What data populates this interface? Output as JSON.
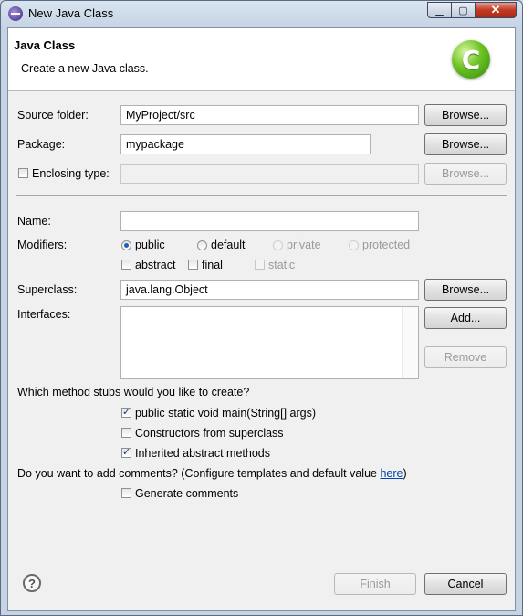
{
  "window": {
    "title": "New Java Class",
    "buttons": {
      "minimize": "▁",
      "maximize": "▢",
      "close": "✕"
    }
  },
  "header": {
    "title": "Java Class",
    "description": "Create a new Java class.",
    "logo_letter": "C"
  },
  "source_folder": {
    "label": "Source folder:",
    "value": "MyProject/src",
    "button": "Browse..."
  },
  "package": {
    "label": "Package:",
    "value": "mypackage",
    "button": "Browse..."
  },
  "enclosing_type": {
    "label": "Enclosing type:",
    "value": "",
    "button": "Browse...",
    "checked": false
  },
  "name": {
    "label": "Name:",
    "value": ""
  },
  "modifiers": {
    "label": "Modifiers:",
    "radios": [
      {
        "label": "public",
        "selected": true,
        "enabled": true
      },
      {
        "label": "default",
        "selected": false,
        "enabled": true
      },
      {
        "label": "private",
        "selected": false,
        "enabled": false
      },
      {
        "label": "protected",
        "selected": false,
        "enabled": false
      }
    ],
    "checks": [
      {
        "label": "abstract",
        "checked": false,
        "enabled": true
      },
      {
        "label": "final",
        "checked": false,
        "enabled": true
      },
      {
        "label": "static",
        "checked": false,
        "enabled": false
      }
    ]
  },
  "superclass": {
    "label": "Superclass:",
    "value": "java.lang.Object",
    "button": "Browse..."
  },
  "interfaces": {
    "label": "Interfaces:",
    "add_button": "Add...",
    "remove_button": "Remove"
  },
  "method_stubs": {
    "question": "Which method stubs would you like to create?",
    "options": [
      {
        "label": "public static void main(String[] args)",
        "checked": true
      },
      {
        "label": "Constructors from superclass",
        "checked": false
      },
      {
        "label": "Inherited abstract methods",
        "checked": true
      }
    ]
  },
  "comments": {
    "question_prefix": "Do you want to add comments? (Configure templates and default value ",
    "link": "here",
    "question_suffix": ")",
    "option": "Generate comments",
    "checked": false
  },
  "footer": {
    "help": "?",
    "finish": "Finish",
    "cancel": "Cancel"
  }
}
